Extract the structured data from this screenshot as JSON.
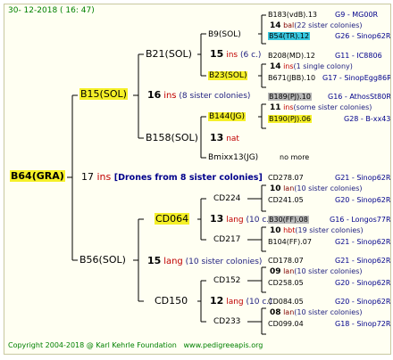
{
  "header": {
    "date": "30-  12-2018  ( 16:  47)"
  },
  "root": {
    "id": "B64(GRA)",
    "count": "17",
    "ins": "ins",
    "note": "[Drones from 8 sister colonies]"
  },
  "gen1": {
    "top": {
      "id": "B15(SOL)",
      "count": "16",
      "ins": "ins",
      "note": "(8 sister colonies)"
    },
    "bottom": {
      "id": "B56(SOL)",
      "count": "15",
      "lang": "lang",
      "note": "(10 sister colonies)"
    }
  },
  "gen2": {
    "a": {
      "id": "B21(SOL)",
      "count": "15",
      "ins": "ins",
      "note": "(6 c.)"
    },
    "b": {
      "id": "B158(SOL)",
      "count": "13",
      "nat": "nat"
    },
    "c": {
      "id": "CD064",
      "count": "13",
      "lang": "lang",
      "note": "(10 c.)"
    },
    "d": {
      "id": "CD150",
      "count": "12",
      "lang": "lang",
      "note": "(10 c.)"
    }
  },
  "gen3": {
    "a": {
      "id": "B9(SOL)"
    },
    "b": {
      "id": "B23(SOL)"
    },
    "c": {
      "id": "B144(JG)"
    },
    "d": {
      "id": "Bmixx13(JG)",
      "note": "no more"
    },
    "e": {
      "id": "CD224"
    },
    "f": {
      "id": "CD217"
    },
    "g": {
      "id": "CD152"
    },
    "h": {
      "id": "CD233"
    }
  },
  "gen4": [
    {
      "id": "B183(vdB).13",
      "code": "G9 - MG00R"
    },
    {
      "count": "14",
      "tag": "bal",
      "note": "(22 sister colonies)"
    },
    {
      "id": "B54(TR).12",
      "code": "G26 - Sinop62R"
    },
    {
      "id": "B208(MD).12",
      "code": "G11 - IC8806"
    },
    {
      "count": "14",
      "tag": "ins",
      "note": "(1 single colony)"
    },
    {
      "id": "B671(JBB).10",
      "code": "G17 - SinopEgg86R"
    },
    {
      "id": "B189(PJ).10",
      "code": "G16 - AthosSt80R"
    },
    {
      "count": "11",
      "tag": "ins",
      "note": "(some sister colonies)"
    },
    {
      "id": "B190(PJ).06",
      "code": "G28 - B-xx43"
    },
    {
      "id": "CD278.07",
      "code": "G21 - Sinop62R"
    },
    {
      "count": "10",
      "tag": "lan",
      "note": "(10 sister colonies)"
    },
    {
      "id": "CD241.05",
      "code": "G20 - Sinop62R"
    },
    {
      "id": "B30(FF).08",
      "code": "G16 - Longos77R"
    },
    {
      "count": "10",
      "tag": "hbt",
      "note": "(19 sister colonies)"
    },
    {
      "id": "B104(FF).07",
      "code": "G21 - Sinop62R"
    },
    {
      "id": "CD178.07",
      "code": "G21 - Sinop62R"
    },
    {
      "count": "09",
      "tag": "lan",
      "note": "(10 sister colonies)"
    },
    {
      "id": "CD258.05",
      "code": "G20 - Sinop62R"
    },
    {
      "id": "CD084.05",
      "code": "G20 - Sinop62R"
    },
    {
      "count": "08",
      "tag": "lan",
      "note": "(10 sister colonies)"
    },
    {
      "id": "CD099.04",
      "code": "G18 - Sinop72R"
    }
  ],
  "footer": {
    "copyright": "Copyright 2004-2018 @ Karl Kehrle Foundation",
    "url": "www.pedigreeapis.org"
  }
}
